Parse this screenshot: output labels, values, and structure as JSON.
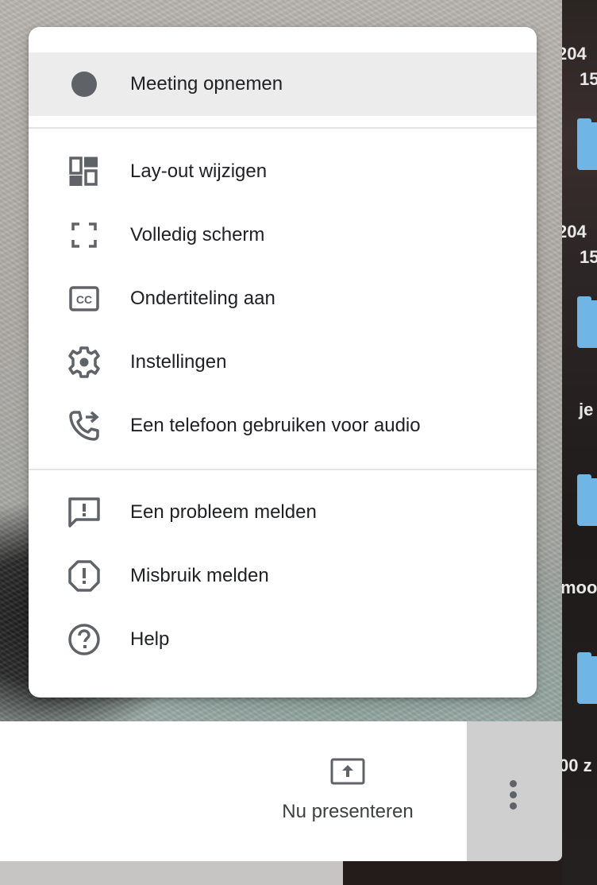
{
  "menu": {
    "record": {
      "label": "Meeting opnemen",
      "icon": "record-dot-icon"
    },
    "items_group1": [
      {
        "label": "Lay-out wijzigen",
        "icon": "layout-icon"
      },
      {
        "label": "Volledig scherm",
        "icon": "fullscreen-icon"
      },
      {
        "label": "Ondertiteling aan",
        "icon": "closed-captions-icon"
      },
      {
        "label": "Instellingen",
        "icon": "gear-icon"
      },
      {
        "label": "Een telefoon gebruiken voor audio",
        "icon": "phone-forward-icon"
      }
    ],
    "items_group2": [
      {
        "label": "Een probleem melden",
        "icon": "feedback-icon"
      },
      {
        "label": "Misbruik melden",
        "icon": "report-abuse-icon"
      },
      {
        "label": "Help",
        "icon": "help-icon"
      }
    ]
  },
  "bottom_bar": {
    "present_label": "Nu presenteren",
    "present_icon": "present-screen-icon",
    "more_icon": "more-vert-icon"
  },
  "desktop_strip": {
    "texts": [
      "204",
      "15",
      "204",
      "15",
      "je",
      "moo",
      "00 z"
    ]
  },
  "colors": {
    "icon_gray": "#5f6368",
    "text": "#202124",
    "highlight": "#ececec",
    "folder_blue": "#6fb6e6"
  }
}
